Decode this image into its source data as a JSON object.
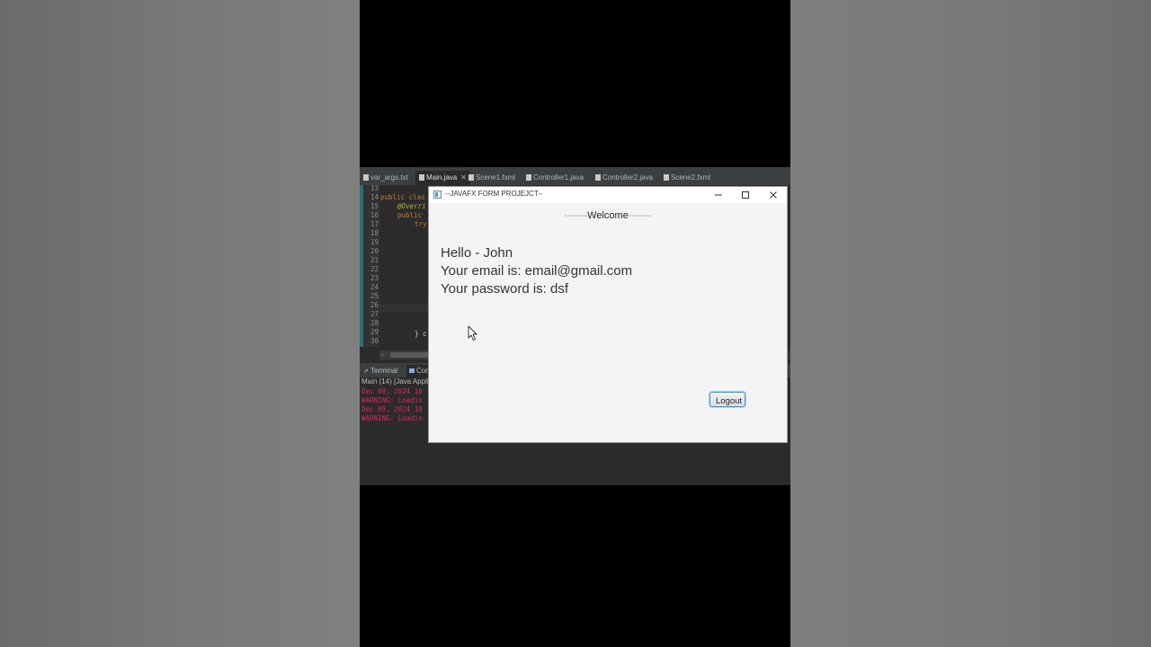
{
  "ide": {
    "tabs": [
      {
        "label": "var_args.txt",
        "active": false
      },
      {
        "label": "Main.java",
        "active": true
      },
      {
        "label": "Scene1.fxml",
        "active": false
      },
      {
        "label": "Controller1.java",
        "active": false
      },
      {
        "label": "Controller2.java",
        "active": false
      },
      {
        "label": "Scene2.fxml",
        "active": false
      }
    ],
    "close_glyph": "✕",
    "line_numbers": [
      "13",
      "14",
      "15",
      "16",
      "17",
      "18",
      "19",
      "20",
      "21",
      "22",
      "23",
      "24",
      "25",
      "26",
      "27",
      "28",
      "29",
      "30"
    ],
    "code_fragments": {
      "line14_kw": "public clas",
      "line15": "@Overri",
      "line16_kw": "public",
      "line17_kw": "try",
      "line29": "} c"
    },
    "scroll_arrow": "‹",
    "console_tabs": [
      {
        "label": "Terminal",
        "active": false
      },
      {
        "label": "Cor",
        "active": true
      }
    ],
    "console_title": "Main (14) [Java Appli",
    "console_lines": [
      "Dec 09, 2024 10",
      "WARNING: Loadin",
      "Dec 09, 2024 10",
      "WARNING: Loadin"
    ]
  },
  "fx_window": {
    "title": "--JAVAFX FORM PROJEJCT--",
    "welcome_left_dashes": "-------",
    "welcome_label": "Welcome",
    "welcome_right_dashes": "-------",
    "greeting": "Hello - John",
    "email_line": "Your email is: email@gmail.com",
    "password_line": "Your password is: dsf",
    "logout_label": "Logout"
  }
}
